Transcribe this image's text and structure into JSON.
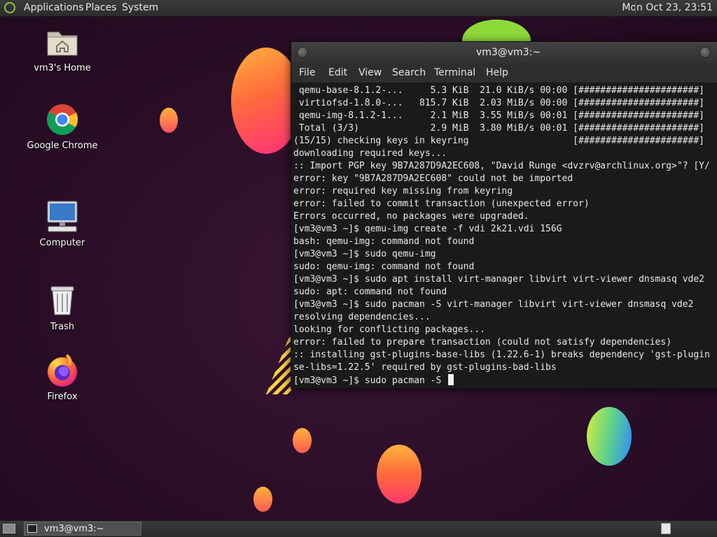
{
  "top_panel": {
    "menus": [
      "Applications",
      "Places",
      "System"
    ],
    "clock": "Mon Oct 23, 23:51"
  },
  "desktop_icons": [
    {
      "label": "vm3's Home",
      "icon": "home-folder-icon"
    },
    {
      "label": "Google Chrome",
      "icon": "chrome-icon"
    },
    {
      "label": "Computer",
      "icon": "computer-icon"
    },
    {
      "label": "Trash",
      "icon": "trash-icon"
    },
    {
      "label": "Firefox",
      "icon": "firefox-icon"
    }
  ],
  "terminal": {
    "title": "vm3@vm3:~",
    "menu": [
      "File",
      "Edit",
      "View",
      "Search",
      "Terminal",
      "Help"
    ],
    "lines": [
      " qemu-base-8.1.2-...     5.3 KiB  21.0 KiB/s 00:00 [######################]",
      " virtiofsd-1.8.0-...   815.7 KiB  2.03 MiB/s 00:00 [######################]",
      " qemu-img-8.1.2-1...     2.1 MiB  3.55 MiB/s 00:01 [######################]",
      " Total (3/3)             2.9 MiB  3.80 MiB/s 00:01 [######################]",
      "(15/15) checking keys in keyring                   [######################]",
      "downloading required keys...",
      ":: Import PGP key 9B7A287D9A2EC608, \"David Runge <dvzrv@archlinux.org>\"? [Y/",
      "error: key \"9B7A287D9A2EC608\" could not be imported",
      "error: required key missing from keyring",
      "error: failed to commit transaction (unexpected error)",
      "Errors occurred, no packages were upgraded.",
      "[vm3@vm3 ~]$ qemu-img create -f vdi 2k21.vdi 156G",
      "bash: qemu-img: command not found",
      "[vm3@vm3 ~]$ sudo qemu-img",
      "sudo: qemu-img: command not found",
      "[vm3@vm3 ~]$ sudo apt install virt-manager libvirt virt-viewer dnsmasq vde2",
      "sudo: apt: command not found",
      "[vm3@vm3 ~]$ sudo pacman -S virt-manager libvirt virt-viewer dnsmasq vde2",
      "resolving dependencies...",
      "looking for conflicting packages...",
      "error: failed to prepare transaction (could not satisfy dependencies)",
      ":: installing gst-plugins-base-libs (1.22.6-1) breaks dependency 'gst-plugin",
      "se-libs=1.22.5' required by gst-plugins-bad-libs"
    ],
    "prompt": "[vm3@vm3 ~]$ sudo pacman -S "
  },
  "taskbar": {
    "window_button": "vm3@vm3:~"
  },
  "colors": {
    "panel": "#333333",
    "desktop_bg": "#2b0e28",
    "terminal_bg": "#1a1a1a",
    "terminal_fg": "#e8e8e8"
  }
}
